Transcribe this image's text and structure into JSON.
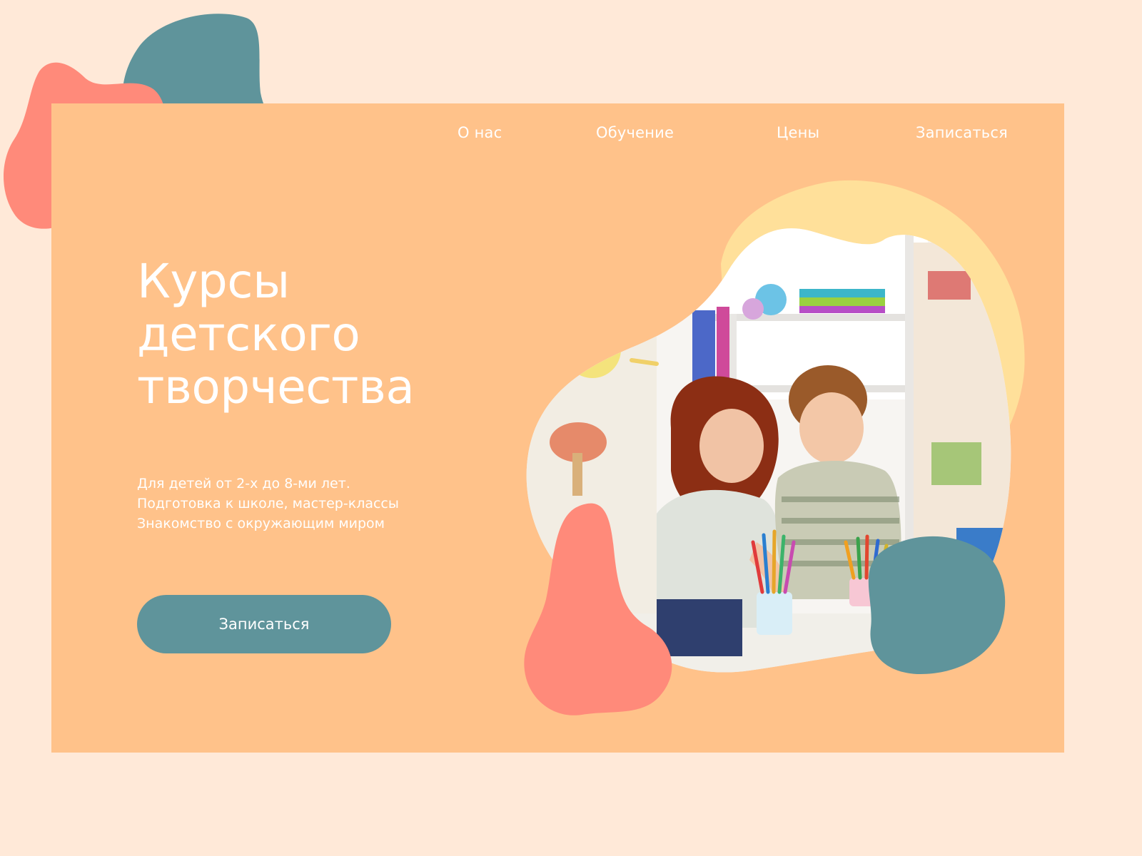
{
  "colors": {
    "page_background": "#ffe9d8",
    "panel": "#ffc28a",
    "teal": "#5f949b",
    "coral": "#ff8a7a",
    "yellow": "#ffe09a",
    "text": "#ffffff"
  },
  "nav": {
    "items": [
      {
        "label": "О нас"
      },
      {
        "label": "Обучение"
      },
      {
        "label": "Цены"
      },
      {
        "label": "Записаться"
      }
    ]
  },
  "hero": {
    "title_lines": [
      "Курсы",
      "детского",
      "творчества"
    ],
    "subtitle_lines": [
      "Для детей от 2-х до 8-ми лет.",
      "Подготовка к школе, мастер-классы",
      "Знакомство с окружающим миром"
    ],
    "cta_label": "Записаться"
  }
}
